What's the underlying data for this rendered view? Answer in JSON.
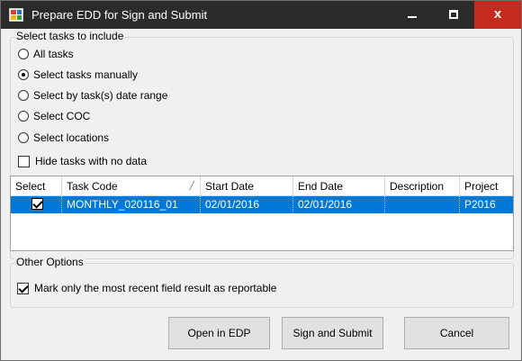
{
  "window": {
    "title": "Prepare EDD for Sign and Submit",
    "controls": {
      "close_glyph": "x"
    }
  },
  "tasks_group": {
    "legend": "Select tasks to include",
    "options": [
      {
        "label": "All tasks",
        "checked": false
      },
      {
        "label": "Select tasks manually",
        "checked": true
      },
      {
        "label": "Select by task(s) date range",
        "checked": false
      },
      {
        "label": "Select COC",
        "checked": false
      },
      {
        "label": "Select locations",
        "checked": false
      }
    ],
    "hide_no_data": {
      "label": "Hide tasks with no data",
      "checked": false
    }
  },
  "grid": {
    "columns": [
      "Select",
      "Task Code",
      "Start Date",
      "End Date",
      "Description",
      "Project"
    ],
    "sort_column": "Task Code",
    "rows": [
      {
        "selected": true,
        "task_code": "MONTHLY_020116_01",
        "start_date": "02/01/2016",
        "end_date": "02/01/2016",
        "description": "",
        "project": "P2016"
      }
    ]
  },
  "other_group": {
    "legend": "Other Options",
    "most_recent": {
      "label": "Mark only the most recent field result as reportable",
      "checked": true
    }
  },
  "buttons": {
    "open_edp": "Open in EDP",
    "sign_submit": "Sign and Submit",
    "cancel": "Cancel"
  },
  "colors": {
    "titlebar": "#2b2b2b",
    "close_button": "#c42b1c",
    "selection": "#0078d7"
  }
}
